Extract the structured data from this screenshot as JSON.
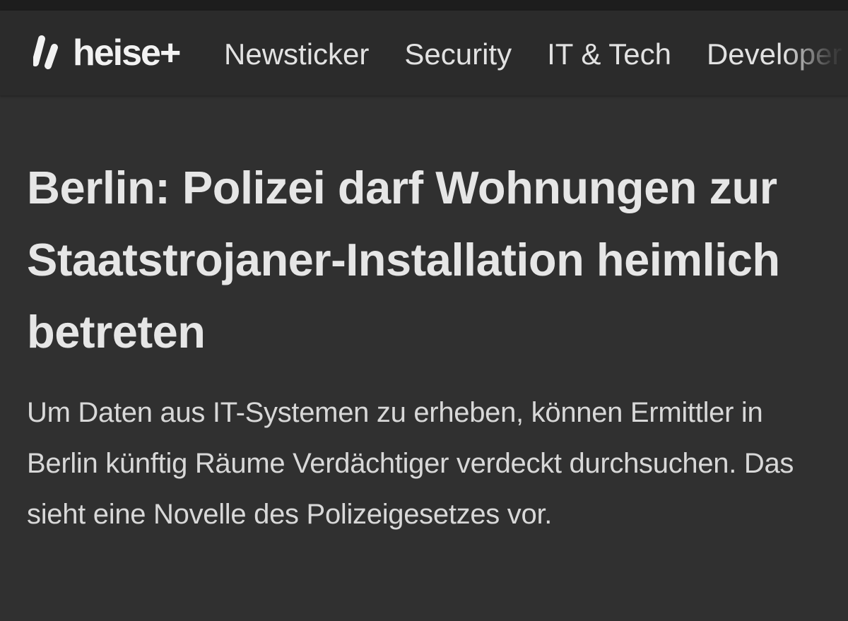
{
  "nav": {
    "logo_text": "heise+",
    "items": [
      "Newsticker",
      "Security",
      "IT & Tech",
      "Developer"
    ]
  },
  "article": {
    "headline": "Berlin: Polizei darf Wohnungen zur Staatstrojaner-Installation heimlich betreten",
    "lead": "Um Daten aus IT-Systemen zu erheben, können Ermittler in Berlin künftig Räume Verdächtiger verdeckt durchsuchen. Das sieht eine Novelle des Polizeigesetzes vor."
  },
  "colors": {
    "background": "#303030",
    "navbar": "#2b2b2b",
    "text": "#e6e6e6"
  }
}
